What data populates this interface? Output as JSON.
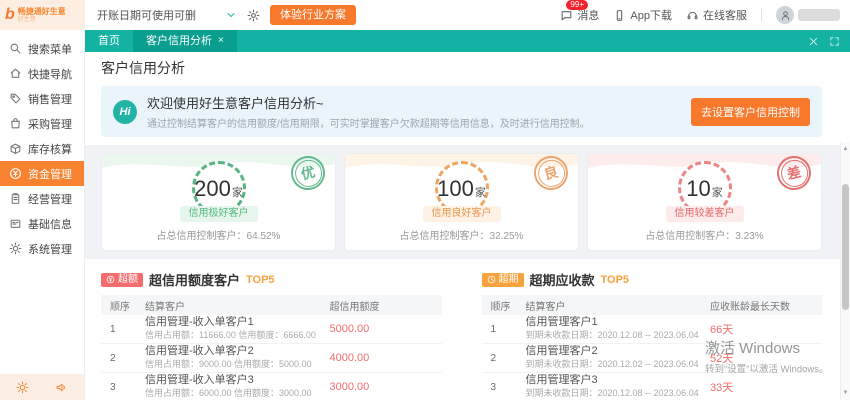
{
  "topbar": {
    "logo_title": "畅捷通好生意",
    "logo_subtitle": "好生意",
    "account_selector": "开账日期可使用可删",
    "trial_button": "体验行业方案",
    "messages_label": "消息",
    "messages_badge": "99+",
    "app_download_label": "App下载",
    "service_label": "在线客服"
  },
  "sidebar": {
    "items": [
      {
        "label": "搜索菜单"
      },
      {
        "label": "快捷导航"
      },
      {
        "label": "销售管理"
      },
      {
        "label": "采购管理"
      },
      {
        "label": "库存核算"
      },
      {
        "label": "资金管理"
      },
      {
        "label": "经营管理"
      },
      {
        "label": "基础信息"
      },
      {
        "label": "系统管理"
      }
    ]
  },
  "tabs": {
    "home": "首页",
    "active": "客户信用分析",
    "close": "×"
  },
  "page": {
    "title": "客户信用分析"
  },
  "banner": {
    "hi": "Hi",
    "title": "欢迎使用好生意客户信用分析~",
    "subtitle": "通过控制结算客户的信用额度/信用期限，可实时掌握客户欠款超期等信用信息，及时进行信用控制。",
    "button": "去设置客户信用控制"
  },
  "cards": [
    {
      "count": "200",
      "unit": "家",
      "badge": "信用极好客户",
      "ratio_label": "占总信用控制客户：64.52%",
      "stamp": "优",
      "color": "#4cae7e"
    },
    {
      "count": "100",
      "unit": "家",
      "badge": "信用良好客户",
      "ratio_label": "占总信用控制客户：32.25%",
      "stamp": "良",
      "color": "#e8975a"
    },
    {
      "count": "10",
      "unit": "家",
      "badge": "信用较差客户",
      "ratio_label": "占总信用控制客户：3.23%",
      "stamp": "差",
      "color": "#e05a5a"
    }
  ],
  "tables": {
    "left": {
      "badge": "超额",
      "title": "超信用额度客户",
      "tops": "TOP5",
      "headers": [
        "顺序",
        "结算客户",
        "超信用额度"
      ],
      "rows": [
        {
          "no": "1",
          "name": "信用管理-收入单客户1",
          "detail": "信用占用额：11666.00  信用额度：6666.00",
          "value": "5000.00"
        },
        {
          "no": "2",
          "name": "信用管理-收入单客户2",
          "detail": "信用占用额：9000.00  信用额度：5000.00",
          "value": "4000.00"
        },
        {
          "no": "3",
          "name": "信用管理-收入单客户3",
          "detail": "信用占用额：6000.00  信用额度：3000.00",
          "value": "3000.00"
        }
      ]
    },
    "right": {
      "badge": "超期",
      "title": "超期应收款",
      "tops": "TOP5",
      "headers": [
        "顺序",
        "结算客户",
        "应收账龄最长天数"
      ],
      "rows": [
        {
          "no": "1",
          "name": "信用管理客户1",
          "detail": "到期未收款日期：2020.12.08 -- 2023.06.04",
          "value": "66天"
        },
        {
          "no": "2",
          "name": "信用管理客户2",
          "detail": "到期未收款日期：2020.12.02 -- 2023.06.04",
          "value": "52天"
        },
        {
          "no": "3",
          "name": "信用管理客户3",
          "detail": "到期未收款日期：2020.12.08 -- 2023.06.04",
          "value": "33天"
        }
      ]
    }
  },
  "watermark": {
    "line1": "激活 Windows",
    "line2": "转到“设置”以激活 Windows。"
  },
  "colors": {
    "teal": "#13b2a2",
    "orange": "#f8782c",
    "red": "#f56c6c",
    "banner_bg": "#e9f4fb"
  }
}
